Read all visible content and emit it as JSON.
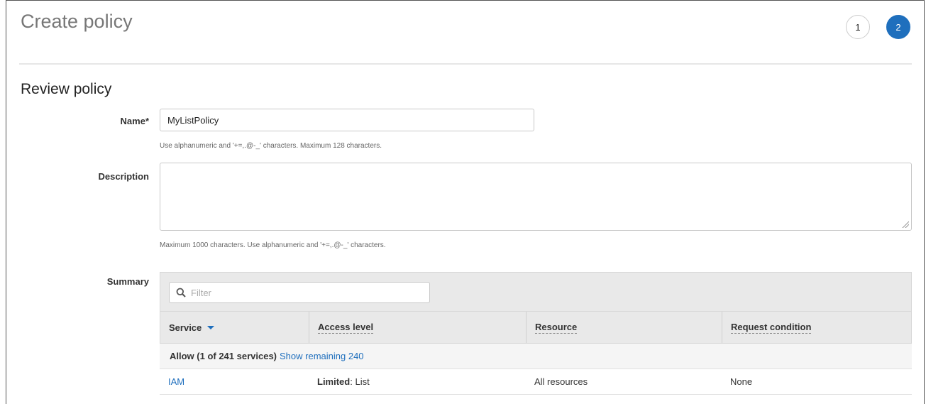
{
  "header": {
    "title": "Create policy",
    "steps": [
      "1",
      "2"
    ],
    "active_step": "2"
  },
  "review": {
    "section_title": "Review policy",
    "name_label": "Name*",
    "name_value": "MyListPolicy",
    "name_hint": "Use alphanumeric and '+=,.@-_' characters. Maximum 128 characters.",
    "description_label": "Description",
    "description_value": "",
    "description_hint": "Maximum 1000 characters. Use alphanumeric and '+=,.@-_' characters.",
    "summary_label": "Summary"
  },
  "summary_table": {
    "filter_placeholder": "Filter",
    "columns": [
      "Service",
      "Access level",
      "Resource",
      "Request condition"
    ],
    "group": {
      "text": "Allow (1 of 241 services)",
      "link": "Show remaining 240"
    },
    "rows": [
      {
        "service": "IAM",
        "access_level_bold": "Limited",
        "access_level_rest": ": List",
        "resource": "All resources",
        "request_condition": "None"
      }
    ]
  },
  "colors": {
    "accent": "#1f6fbd",
    "title_gray": "#777777",
    "table_header_bg": "#e9e9e9"
  },
  "icons": {
    "filter": "search-icon",
    "sort": "caret-down-icon",
    "resize": "resize-grip-icon"
  }
}
